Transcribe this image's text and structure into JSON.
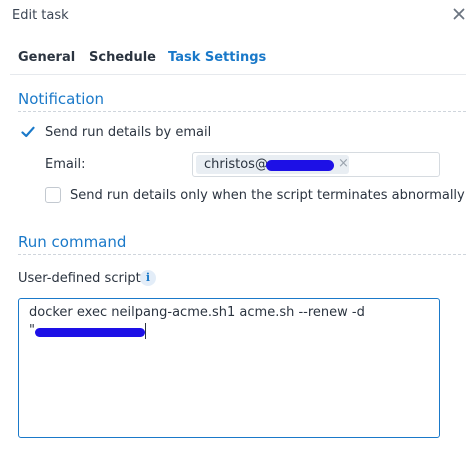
{
  "dialog": {
    "title": "Edit task"
  },
  "tabs": [
    {
      "label": "General",
      "active": false
    },
    {
      "label": "Schedule",
      "active": false
    },
    {
      "label": "Task Settings",
      "active": true
    }
  ],
  "notification": {
    "heading": "Notification",
    "send_email_label": "Send run details by email",
    "send_email_checked": true,
    "email_label": "Email:",
    "email_value": "christos@",
    "abnormal_label": "Send run details only when the script terminates abnormally",
    "abnormal_checked": false
  },
  "run_command": {
    "heading": "Run command",
    "script_label": "User-defined script",
    "script_line1": "docker exec neilpang-acme.sh1 acme.sh --renew -d",
    "script_line2": "\""
  },
  "colors": {
    "accent": "#1a79c9",
    "redaction": "#1d10e6"
  },
  "icons": {
    "close": "close-icon",
    "check": "checkmark-icon",
    "info": "info-icon",
    "tag_remove": "remove-tag-icon"
  }
}
